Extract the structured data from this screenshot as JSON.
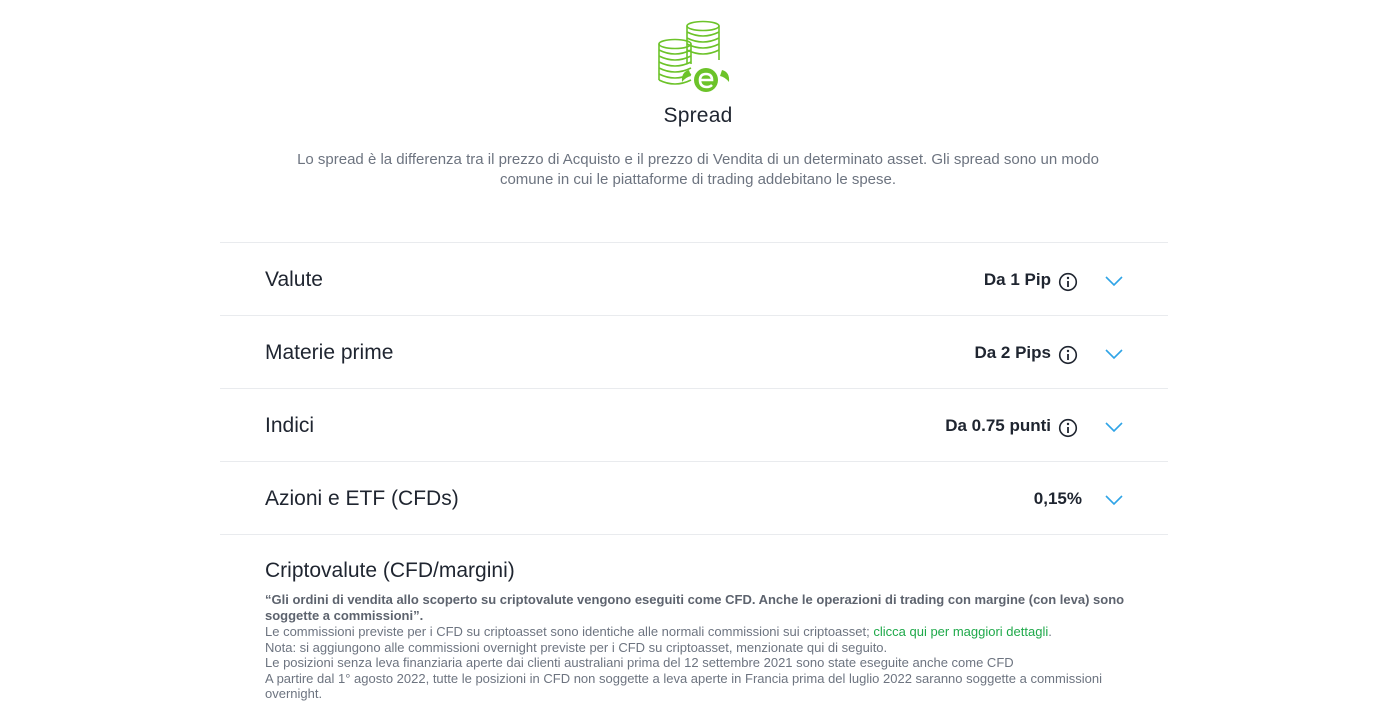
{
  "header": {
    "icon": "coins-etoro-icon",
    "title": "Spread",
    "intro": "Lo spread è la differenza tra il prezzo di Acquisto e il prezzo di Vendita di un determinato asset. Gli spread sono un modo comune in cui le piattaforme di trading addebitano le spese."
  },
  "colors": {
    "accent_green": "#6cc329",
    "link_green": "#1fa94a",
    "chevron_blue": "#2fa4e7"
  },
  "rows": [
    {
      "label": "Valute",
      "value": "Da 1 Pip",
      "info_icon": "info-icon",
      "chevron_icon": "chevron-down-icon"
    },
    {
      "label": "Materie prime",
      "value": "Da 2 Pips",
      "info_icon": "info-icon",
      "chevron_icon": "chevron-down-icon"
    },
    {
      "label": "Indici",
      "value": "Da 0.75 punti",
      "info_icon": "info-icon",
      "chevron_icon": "chevron-down-icon"
    },
    {
      "label": "Azioni e ETF (CFDs)",
      "value": "0,15%",
      "chevron_icon": "chevron-down-icon"
    }
  ],
  "crypto": {
    "title": "Criptovalute (CFD/margini)",
    "quote": "“Gli ordini di vendita allo scoperto su criptovalute vengono eseguiti come CFD. Anche le operazioni di trading con margine (con leva) sono soggette a commissioni”.",
    "line1_text": "Le commissioni previste per i CFD su criptoasset sono identiche alle normali commissioni sui criptoasset; ",
    "line1_link": "clicca qui per maggiori dettagli",
    "line1_end": ".",
    "line2": "Nota: si aggiungono alle commissioni overnight previste per i CFD su criptoasset, menzionate qui di seguito.",
    "line3": "Le posizioni senza leva finanziaria aperte dai clienti australiani prima del 12 settembre 2021 sono state eseguite anche come CFD",
    "line4": "A partire dal 1° agosto 2022, tutte le posizioni in CFD non soggette a leva aperte in Francia prima del luglio 2022 saranno soggette a commissioni overnight."
  }
}
